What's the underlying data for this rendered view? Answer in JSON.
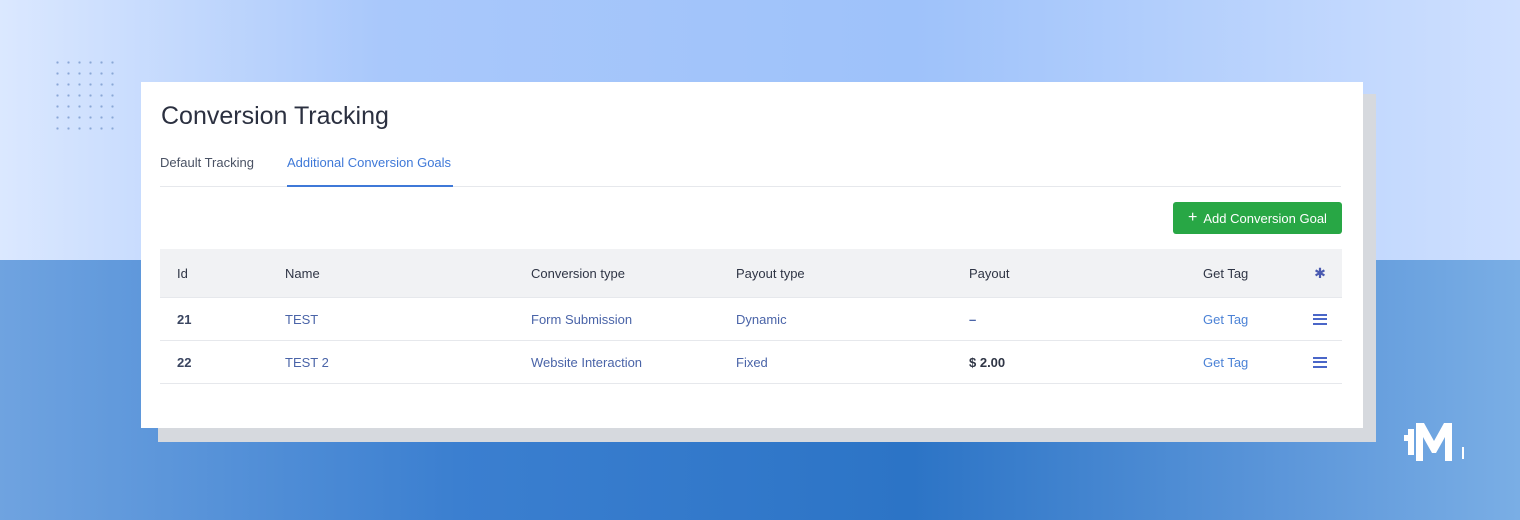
{
  "page_title": "Conversion Tracking",
  "tabs": [
    {
      "label": "Default Tracking",
      "active": false
    },
    {
      "label": "Additional Conversion Goals",
      "active": true
    }
  ],
  "add_button": {
    "icon": "plus-icon",
    "label": "Add Conversion Goal"
  },
  "table": {
    "columns": [
      "Id",
      "Name",
      "Conversion type",
      "Payout type",
      "Payout",
      "Get Tag"
    ],
    "settings_icon": "gear-icon",
    "rows": [
      {
        "id": "21",
        "name": "TEST",
        "conversion_type": "Form Submission",
        "payout_type": "Dynamic",
        "payout": "–",
        "tag": "Get Tag",
        "menu_icon": "hamburger-menu-icon"
      },
      {
        "id": "22",
        "name": "TEST 2",
        "conversion_type": "Website Interaction",
        "payout_type": "Fixed",
        "payout": "$ 2.00",
        "tag": "Get Tag",
        "menu_icon": "hamburger-menu-icon"
      }
    ]
  },
  "colors": {
    "accent": "#3f79d8",
    "button_green": "#28a745",
    "link": "#4b82d6"
  }
}
